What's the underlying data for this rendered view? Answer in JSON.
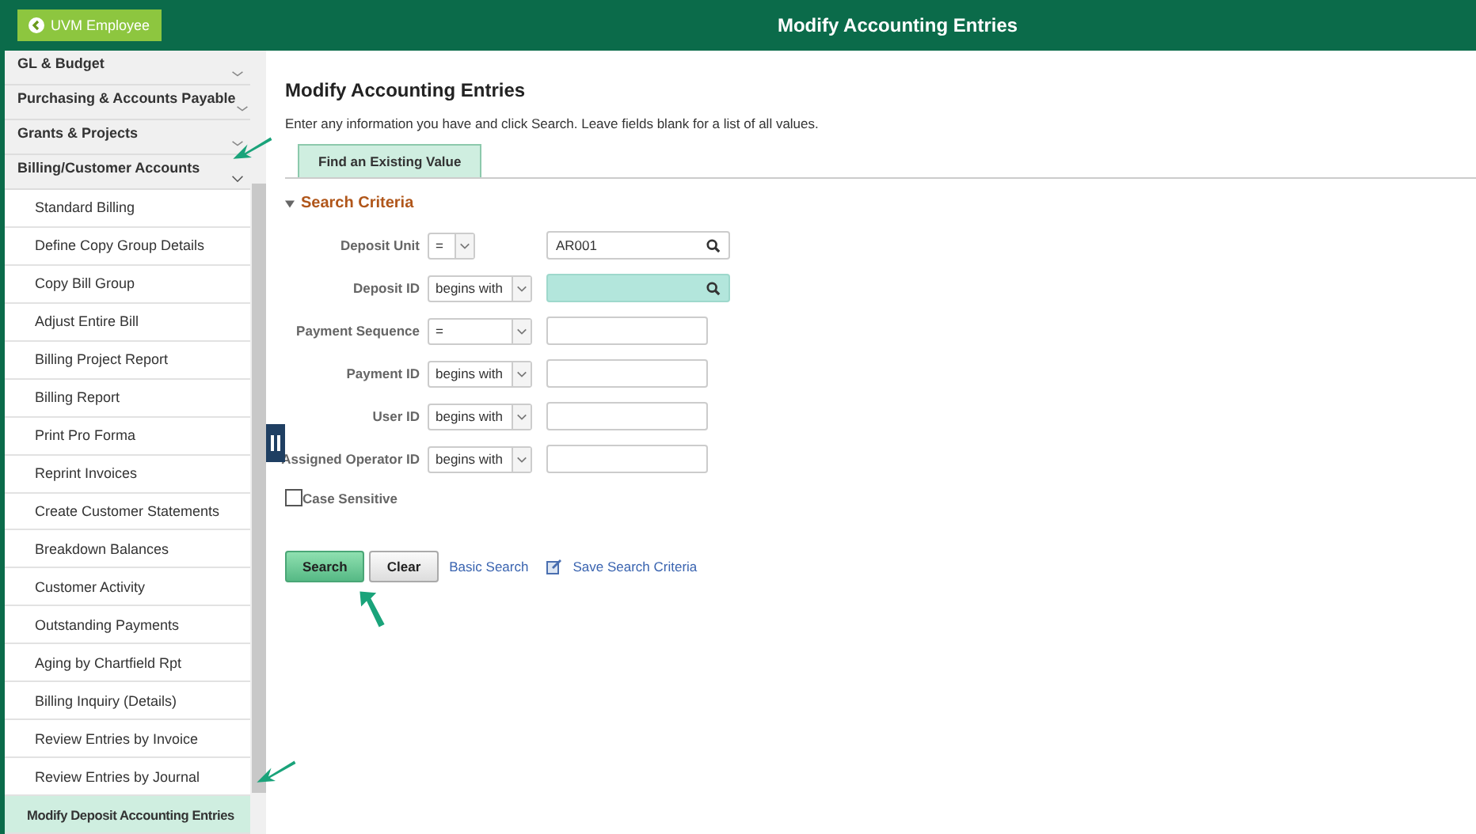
{
  "header": {
    "back_button": "UVM Employee",
    "title": "Modify Accounting Entries"
  },
  "sidebar": {
    "categories": [
      {
        "label": "GL & Budget",
        "expanded": false
      },
      {
        "label": "Purchasing & Accounts Payable",
        "expanded": false
      },
      {
        "label": "Grants & Projects",
        "expanded": false
      },
      {
        "label": "Billing/Customer Accounts",
        "expanded": true
      }
    ],
    "items": [
      {
        "label": "Standard Billing",
        "selected": false
      },
      {
        "label": "Define Copy Group Details",
        "selected": false
      },
      {
        "label": "Copy Bill Group",
        "selected": false
      },
      {
        "label": "Adjust Entire Bill",
        "selected": false
      },
      {
        "label": "Billing Project Report",
        "selected": false
      },
      {
        "label": "Billing Report",
        "selected": false
      },
      {
        "label": "Print Pro Forma",
        "selected": false
      },
      {
        "label": "Reprint Invoices",
        "selected": false
      },
      {
        "label": "Create Customer Statements",
        "selected": false
      },
      {
        "label": "Breakdown Balances",
        "selected": false
      },
      {
        "label": "Customer Activity",
        "selected": false
      },
      {
        "label": "Outstanding Payments",
        "selected": false
      },
      {
        "label": "Aging by Chartfield Rpt",
        "selected": false
      },
      {
        "label": "Billing Inquiry (Details)",
        "selected": false
      },
      {
        "label": "Review Entries by Invoice",
        "selected": false
      },
      {
        "label": "Review Entries by Journal",
        "selected": false
      },
      {
        "label": "Modify Deposit Accounting Entries",
        "selected": true
      }
    ]
  },
  "page": {
    "heading": "Modify Accounting Entries",
    "instructions": "Enter any information you have and click Search. Leave fields blank for a list of all values.",
    "tabs": [
      {
        "label": "Find an Existing Value",
        "selected": true
      }
    ],
    "section": {
      "label": "Search Criteria",
      "expanded": true
    },
    "fields": [
      {
        "label": "Deposit Unit",
        "operator": "=",
        "narrow": true,
        "value": "AR001",
        "lookup": true,
        "focused": false
      },
      {
        "label": "Deposit ID",
        "operator": "begins with",
        "narrow": false,
        "lookup": true,
        "focused": true
      },
      {
        "label": "Payment Sequence",
        "operator": "=",
        "narrow": false,
        "lookup": false,
        "focused": false
      },
      {
        "label": "Payment ID",
        "operator": "begins with",
        "narrow": false,
        "lookup": false,
        "focused": false
      },
      {
        "label": "User ID",
        "operator": "begins with",
        "narrow": false,
        "lookup": false,
        "focused": false
      },
      {
        "label": "Assigned Operator ID",
        "operator": "begins with",
        "narrow": false,
        "lookup": false,
        "focused": false
      }
    ],
    "case_sensitive": {
      "label": "Case Sensitive",
      "checked": false
    },
    "buttons": [
      "Search",
      "Clear"
    ],
    "links": [
      "Basic Search",
      "Save Search Criteria"
    ]
  }
}
